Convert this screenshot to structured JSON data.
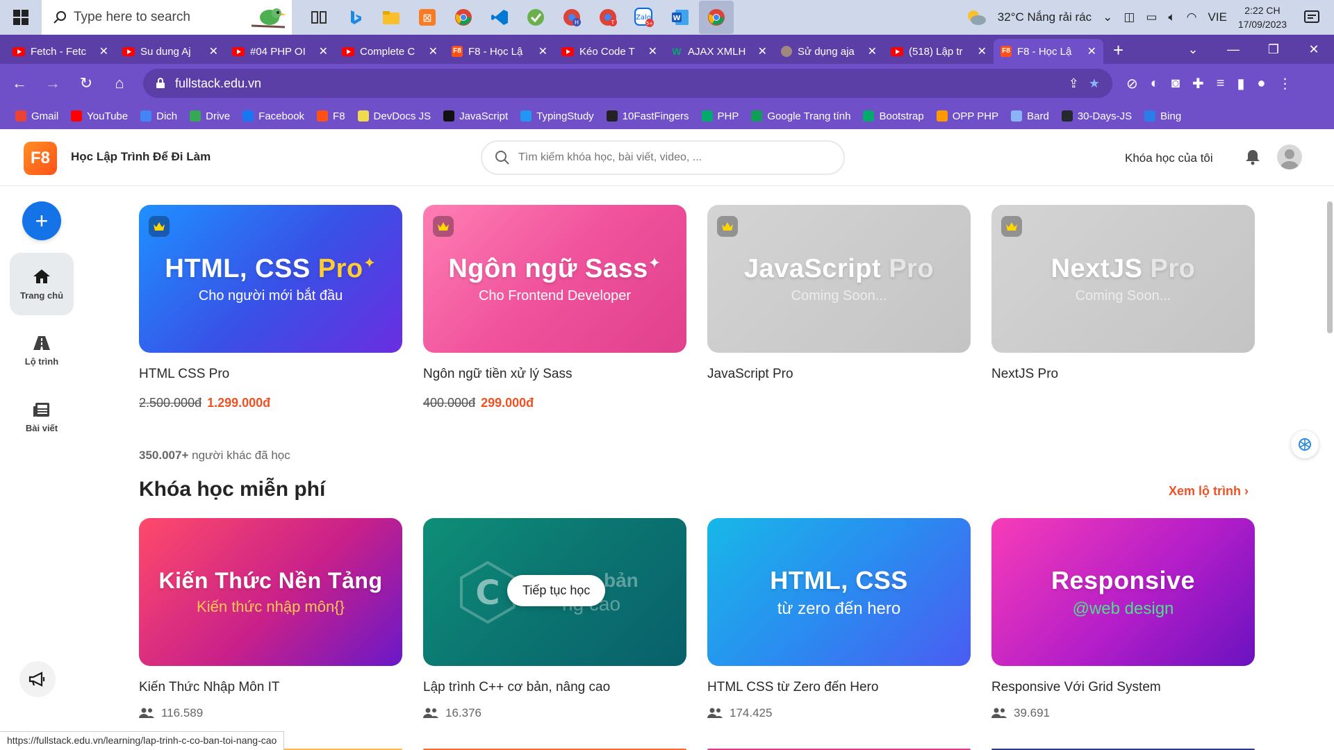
{
  "taskbar": {
    "search_placeholder": "Type here to search",
    "weather": "32°C  Nắng rải rác",
    "lang": "VIE",
    "time": "2:22 CH",
    "date": "17/09/2023"
  },
  "tabs": [
    {
      "label": "Fetch - Fetc",
      "icon": "youtube-icon"
    },
    {
      "label": "Su dung Aj",
      "icon": "youtube-icon"
    },
    {
      "label": "#04 PHP OI",
      "icon": "youtube-icon"
    },
    {
      "label": "Complete C",
      "icon": "youtube-icon"
    },
    {
      "label": "F8 - Học Lậ",
      "icon": "f8-icon"
    },
    {
      "label": "Kéo Code T",
      "icon": "youtube-icon"
    },
    {
      "label": "AJAX XMLH",
      "icon": "w3schools-icon"
    },
    {
      "label": "Sử dụng aja",
      "icon": "avatar-icon"
    },
    {
      "label": "(518) Lập tr",
      "icon": "youtube-icon"
    },
    {
      "label": "F8 - Học Lậ",
      "icon": "f8-icon",
      "active": true
    }
  ],
  "browser": {
    "url": "fullstack.edu.vn"
  },
  "bookmarks": [
    {
      "label": "Gmail",
      "color": "#ea4335"
    },
    {
      "label": "YouTube",
      "color": "#ff0000"
    },
    {
      "label": "Dich",
      "color": "#4285f4"
    },
    {
      "label": "Drive",
      "color": "#34a853"
    },
    {
      "label": "Facebook",
      "color": "#1877f2"
    },
    {
      "label": "F8",
      "color": "#ff5117"
    },
    {
      "label": "DevDocs JS",
      "color": "#f0db4f"
    },
    {
      "label": "JavaScript",
      "color": "#111111"
    },
    {
      "label": "TypingStudy",
      "color": "#2196f3"
    },
    {
      "label": "10FastFingers",
      "color": "#222222"
    },
    {
      "label": "PHP",
      "color": "#04aa6d"
    },
    {
      "label": "Google Trang tính",
      "color": "#0f9d58"
    },
    {
      "label": "Bootstrap",
      "color": "#04aa6d"
    },
    {
      "label": "OPP PHP",
      "color": "#ff9900"
    },
    {
      "label": "Bard",
      "color": "#8ab4f8"
    },
    {
      "label": "30-Days-JS",
      "color": "#24292e"
    },
    {
      "label": "Bing",
      "color": "#2b7de9"
    }
  ],
  "header": {
    "logo": "F8",
    "title": "Học Lập Trình Để Đi Làm",
    "search_placeholder": "Tìm kiếm khóa học, bài viết, video, ...",
    "my_courses": "Khóa học của tôi"
  },
  "sidebar": {
    "items": [
      {
        "label": "Trang chủ",
        "icon": "home-icon",
        "active": true
      },
      {
        "label": "Lộ trình",
        "icon": "road-icon"
      },
      {
        "label": "Bài viết",
        "icon": "newspaper-icon"
      }
    ]
  },
  "pro_courses": [
    {
      "title": "HTML CSS Pro",
      "thumb_big": "HTML, CSS",
      "thumb_pro": "Pro",
      "thumb_small": "Cho người mới bắt đầu",
      "old_price": "2.500.000đ",
      "new_price": "1.299.000đ"
    },
    {
      "title": "Ngôn ngữ tiền xử lý Sass",
      "thumb_big": "Ngôn ngữ Sass",
      "thumb_pro": "",
      "thumb_small": "Cho Frontend Developer",
      "old_price": "400.000đ",
      "new_price": "299.000đ"
    },
    {
      "title": "JavaScript Pro",
      "thumb_big": "JavaScript",
      "thumb_pro": "Pro",
      "thumb_small": "Coming Soon...",
      "old_price": "",
      "new_price": ""
    },
    {
      "title": "NextJS Pro",
      "thumb_big": "NextJS",
      "thumb_pro": "Pro",
      "thumb_small": "Coming Soon...",
      "old_price": "",
      "new_price": ""
    }
  ],
  "learners": {
    "count": "350.007+",
    "text": "người khác đã học"
  },
  "free_section": {
    "title": "Khóa học miễn phí",
    "see_route": "Xem lộ trình ›"
  },
  "free_courses": [
    {
      "title": "Kiến Thức Nhập Môn IT",
      "thumb_big": "Kiến Thức Nền Tảng",
      "thumb_small": "Kiến thức nhập môn{}",
      "students": "116.589"
    },
    {
      "title": "Lập trình C++ cơ bản, nâng cao",
      "thumb_big": "bản",
      "thumb_small": "ng cao",
      "students": "16.376"
    },
    {
      "title": "HTML CSS từ Zero đến Hero",
      "thumb_big": "HTML, CSS",
      "thumb_small": "từ zero đến hero",
      "students": "174.425"
    },
    {
      "title": "Responsive Với Grid System",
      "thumb_big": "Responsive",
      "thumb_small": "@web design",
      "students": "39.691"
    }
  ],
  "tooltip": "Tiếp tục học",
  "status_url": "https://fullstack.edu.vn/learning/lap-trinh-c-co-ban-toi-nang-cao"
}
